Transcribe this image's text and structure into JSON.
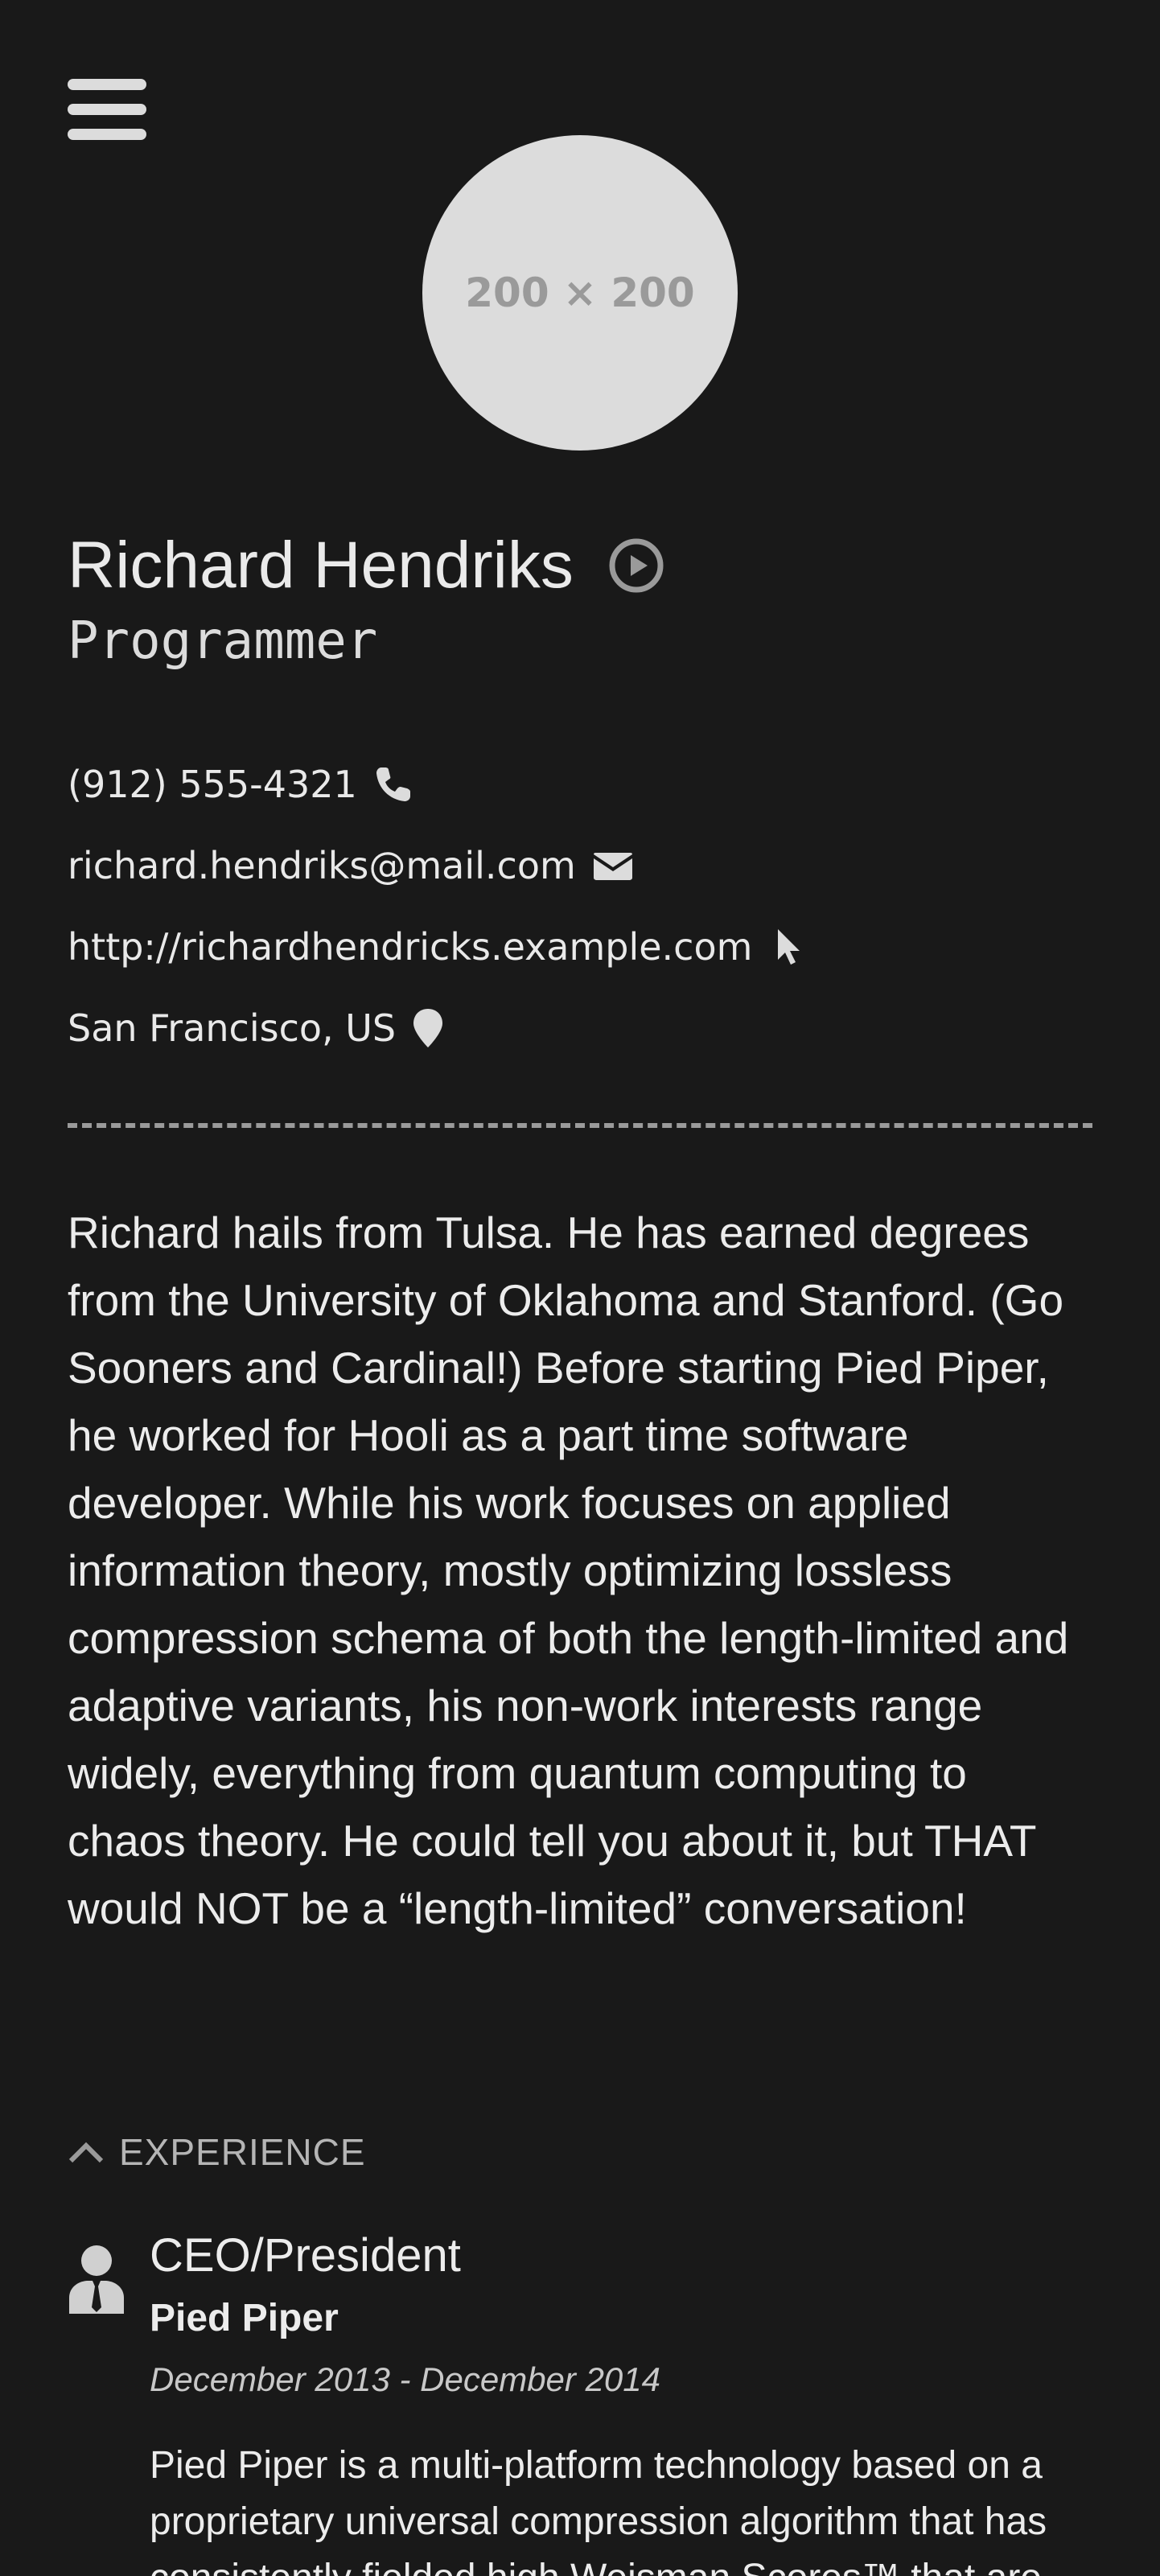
{
  "header": {
    "menu_icon": "hamburger-menu-icon",
    "avatar_placeholder": "200 × 200"
  },
  "profile": {
    "name": "Richard Hendriks",
    "name_icon": "play-circle-icon",
    "title": "Programmer"
  },
  "contact": {
    "phone": "(912) 555-4321",
    "phone_icon": "phone-icon",
    "email": "richard.hendriks@mail.com",
    "email_icon": "envelope-icon",
    "website": "http://richardhendricks.example.com",
    "website_icon": "cursor-pointer-icon",
    "location": "San Francisco, US",
    "location_icon": "map-marker-icon"
  },
  "bio": "Richard hails from Tulsa. He has earned degrees from the University of Oklahoma and Stanford. (Go Sooners and Cardinal!) Before starting Pied Piper, he worked for Hooli as a part time software developer. While his work focuses on applied information theory, mostly optimizing lossless compression schema of both the length-limited and adaptive variants, his non-work interests range widely, everything from quantum computing to chaos theory. He could tell you about it, but THAT would NOT be a “length-limited” conversation!",
  "experience": {
    "section_label": "EXPERIENCE",
    "collapse_icon": "chevron-up-icon",
    "jobs": [
      {
        "icon": "person-tie-icon",
        "position": "CEO/President",
        "company": "Pied Piper",
        "dates": "December 2013 - December 2014",
        "summary": "Pied Piper is a multi-platform technology based on a proprietary universal compression algorithm that has consistently fielded high Weisman Scores™ that are"
      }
    ]
  },
  "colors": {
    "background": "#191919",
    "text": "#e9e9e9",
    "muted": "#b5b5b5",
    "avatar": "#dcdcdc"
  }
}
